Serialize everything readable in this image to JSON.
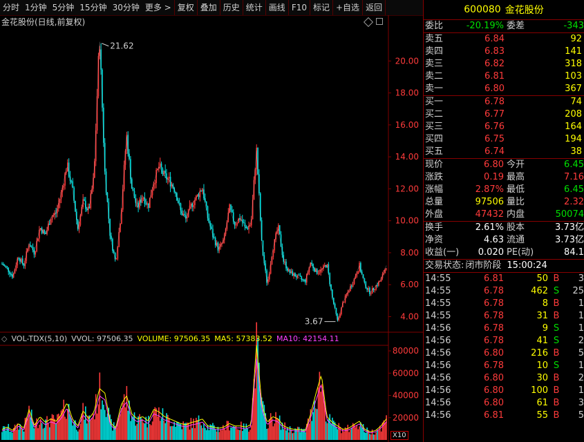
{
  "toolbar": {
    "periods": [
      "分时",
      "1分钟",
      "5分钟",
      "15分钟",
      "30分钟",
      "更多 >"
    ],
    "actions": [
      "复权",
      "叠加",
      "历史",
      "统计",
      "画线",
      "F10",
      "标记",
      "+自选",
      "返回"
    ]
  },
  "kline_legend": "金花股份(日线,前复权)",
  "annotations": {
    "high": "21.62",
    "low": "3.67"
  },
  "price_axis": [
    "20.00",
    "18.00",
    "16.00",
    "14.00",
    "12.00",
    "10.00",
    "8.00",
    "6.00",
    "4.00"
  ],
  "volume_axis": [
    "80000",
    "60000",
    "40000",
    "20000"
  ],
  "volume_legend": {
    "name": "VOL-TDX(5,10)",
    "vvol": "VVOL: 97506.35",
    "volume": "VOLUME: 97506.35",
    "ma5": "MA5: 57383.52",
    "ma10": "MA10: 42154.11"
  },
  "x10": "X10",
  "chart_data": [
    {
      "type": "line",
      "title": "金花股份(日线,前复权)",
      "ylim": [
        3.2,
        22.0
      ],
      "ytick_labels": [
        "20.00",
        "18.00",
        "16.00",
        "14.00",
        "12.00",
        "10.00",
        "8.00",
        "6.00",
        "4.00"
      ],
      "series": [
        {
          "values": [
            7.3,
            7.0,
            6.5,
            7.8,
            7.2,
            8.6,
            8.0,
            9.6,
            9.1,
            10.2,
            10.5,
            11.8,
            13.5,
            12.0,
            9.5,
            11.2,
            10.6,
            12.8,
            21.6,
            13.0,
            9.0,
            7.4,
            10.5,
            15.4,
            12.0,
            10.8,
            11.6,
            10.9,
            12.4,
            13.4,
            12.8,
            12.5,
            11.9,
            10.6,
            10.1,
            11.0,
            11.5,
            12.1,
            10.2,
            9.0,
            8.2,
            8.8,
            10.8,
            9.8,
            10.2,
            9.5,
            9.8,
            14.5,
            8.4,
            6.0,
            8.2,
            9.6,
            7.5,
            6.8,
            6.6,
            6.4,
            6.2,
            7.4,
            6.8,
            6.9,
            7.3,
            5.2,
            3.7,
            4.9,
            5.6,
            6.3,
            7.2,
            6.0,
            5.5,
            5.9,
            6.3,
            7.2
          ]
        }
      ]
    },
    {
      "type": "bar",
      "title": "VOL-TDX(5,10)",
      "ylim": [
        0,
        85000
      ],
      "ytick_labels": [
        "80000",
        "60000",
        "40000",
        "20000"
      ],
      "series": [
        {
          "values": [
            9000,
            11000,
            8000,
            14000,
            10000,
            26000,
            12000,
            20000,
            15000,
            18000,
            16000,
            22000,
            32000,
            18000,
            12000,
            25000,
            18000,
            24000,
            44000,
            40000,
            15000,
            10000,
            30000,
            38000,
            22000,
            18000,
            20000,
            16000,
            26000,
            24000,
            20000,
            18000,
            16000,
            14000,
            13000,
            15000,
            16000,
            18000,
            12000,
            11000,
            10000,
            11000,
            14000,
            12000,
            12000,
            11000,
            13000,
            82000,
            30000,
            15000,
            20000,
            18000,
            12000,
            10000,
            9000,
            9000,
            8000,
            22000,
            40000,
            56000,
            20000,
            15000,
            12000,
            9000,
            10000,
            13000,
            16000,
            9000,
            7000,
            8000,
            12000,
            18000
          ]
        }
      ]
    }
  ],
  "quote": {
    "code": "600080",
    "name": "金花股份",
    "webi_label": "委比",
    "webi": "-20.19%",
    "weicha_label": "委差",
    "weicha": "-343",
    "asks": [
      {
        "label": "卖五",
        "price": "6.84",
        "vol": "92"
      },
      {
        "label": "卖四",
        "price": "6.83",
        "vol": "141"
      },
      {
        "label": "卖三",
        "price": "6.82",
        "vol": "318"
      },
      {
        "label": "卖二",
        "price": "6.81",
        "vol": "103"
      },
      {
        "label": "卖一",
        "price": "6.80",
        "vol": "367"
      }
    ],
    "bids": [
      {
        "label": "买一",
        "price": "6.78",
        "vol": "74"
      },
      {
        "label": "买二",
        "price": "6.77",
        "vol": "208"
      },
      {
        "label": "买三",
        "price": "6.76",
        "vol": "164"
      },
      {
        "label": "买四",
        "price": "6.75",
        "vol": "194"
      },
      {
        "label": "买五",
        "price": "6.74",
        "vol": "38"
      }
    ],
    "stats1": [
      {
        "l1": "现价",
        "v1": "6.80",
        "c1": "red",
        "l2": "今开",
        "v2": "6.45",
        "c2": "green"
      },
      {
        "l1": "涨跌",
        "v1": "0.19",
        "c1": "red",
        "l2": "最高",
        "v2": "7.16",
        "c2": "red"
      },
      {
        "l1": "涨幅",
        "v1": "2.87%",
        "c1": "red",
        "l2": "最低",
        "v2": "6.45",
        "c2": "green"
      },
      {
        "l1": "总量",
        "v1": "97506",
        "c1": "yel",
        "l2": "量比",
        "v2": "2.32",
        "c2": "red"
      },
      {
        "l1": "外盘",
        "v1": "47432",
        "c1": "red",
        "l2": "内盘",
        "v2": "50074",
        "c2": "green"
      }
    ],
    "stats2": [
      {
        "l1": "换手",
        "v1": "2.61%",
        "c1": "wht",
        "l2": "股本",
        "v2": "3.73亿",
        "c2": "wht"
      },
      {
        "l1": "净资",
        "v1": "4.63",
        "c1": "wht",
        "l2": "流通",
        "v2": "3.73亿",
        "c2": "wht"
      },
      {
        "l1": "收益(一)",
        "v1": "0.020",
        "c1": "wht",
        "l2": "PE(动)",
        "v2": "84.1",
        "c2": "wht"
      }
    ],
    "status_label": "交易状态:",
    "status": "闭市阶段",
    "status_time": "15:00:24"
  },
  "ticks": [
    {
      "t": "14:55",
      "p": "6.81",
      "pc": "red",
      "v": "50",
      "s": "B",
      "n": "3"
    },
    {
      "t": "14:55",
      "p": "6.78",
      "pc": "red",
      "v": "462",
      "s": "S",
      "n": "25"
    },
    {
      "t": "14:55",
      "p": "6.78",
      "pc": "red",
      "v": "8",
      "s": "B",
      "n": "1"
    },
    {
      "t": "14:55",
      "p": "6.78",
      "pc": "red",
      "v": "31",
      "s": "B",
      "n": "1"
    },
    {
      "t": "14:56",
      "p": "6.78",
      "pc": "red",
      "v": "9",
      "s": "S",
      "n": "1"
    },
    {
      "t": "14:56",
      "p": "6.78",
      "pc": "red",
      "v": "41",
      "s": "S",
      "n": "2"
    },
    {
      "t": "14:56",
      "p": "6.80",
      "pc": "red",
      "v": "216",
      "s": "B",
      "n": "5"
    },
    {
      "t": "14:56",
      "p": "6.78",
      "pc": "red",
      "v": "10",
      "s": "S",
      "n": "1"
    },
    {
      "t": "14:56",
      "p": "6.80",
      "pc": "red",
      "v": "30",
      "s": "B",
      "n": "2"
    },
    {
      "t": "14:56",
      "p": "6.80",
      "pc": "red",
      "v": "100",
      "s": "B",
      "n": "1"
    },
    {
      "t": "14:56",
      "p": "6.80",
      "pc": "red",
      "v": "61",
      "s": "B",
      "n": "3"
    },
    {
      "t": "14:56",
      "p": "6.81",
      "pc": "red",
      "v": "55",
      "s": "B",
      "n": "5"
    }
  ],
  "colors": {
    "up": "#ff3b3b",
    "down": "#00e0e0",
    "ma5": "#ffff00",
    "ma10": "#ff40ff",
    "grid": "#800000"
  }
}
